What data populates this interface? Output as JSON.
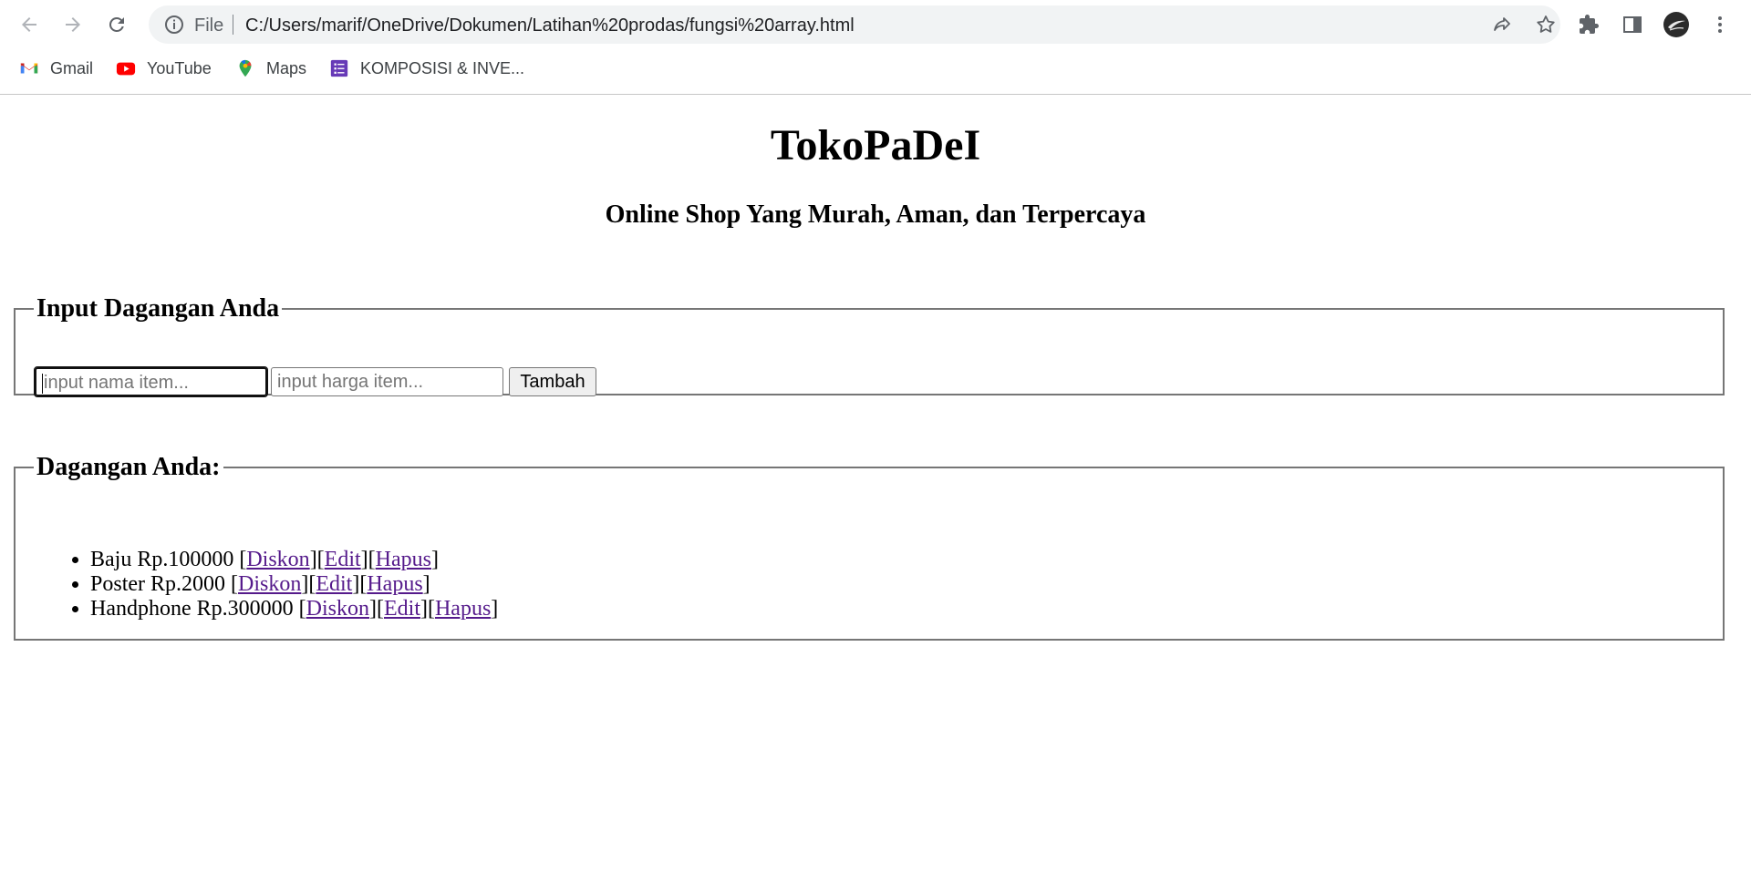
{
  "browser": {
    "omnibox": {
      "scheme_label": "File",
      "url": "C:/Users/marif/OneDrive/Dokumen/Latihan%20prodas/fungsi%20array.html"
    },
    "bookmarks": [
      {
        "label": "Gmail",
        "icon": "gmail-icon"
      },
      {
        "label": "YouTube",
        "icon": "youtube-icon"
      },
      {
        "label": "Maps",
        "icon": "maps-icon"
      },
      {
        "label": "KOMPOSISI & INVE...",
        "icon": "forms-icon"
      }
    ]
  },
  "page": {
    "title": "TokoPaDeI",
    "subtitle": "Online Shop Yang Murah, Aman, dan Terpercaya",
    "input_section": {
      "legend": "Input Dagangan Anda",
      "name_placeholder": "input nama item...",
      "price_placeholder": "input harga item...",
      "add_button": "Tambah"
    },
    "list_section": {
      "legend": "Dagangan Anda:",
      "items": [
        {
          "text": "Baju Rp.100000",
          "diskon": "Diskon",
          "edit": "Edit",
          "hapus": "Hapus"
        },
        {
          "text": "Poster Rp.2000",
          "diskon": "Diskon",
          "edit": "Edit",
          "hapus": "Hapus"
        },
        {
          "text": "Handphone Rp.300000",
          "diskon": "Diskon",
          "edit": "Edit",
          "hapus": "Hapus"
        }
      ]
    }
  },
  "colors": {
    "link_visited": "#551a8b",
    "omnibox_bg": "#f1f3f4",
    "fieldset_border": "#767676"
  }
}
